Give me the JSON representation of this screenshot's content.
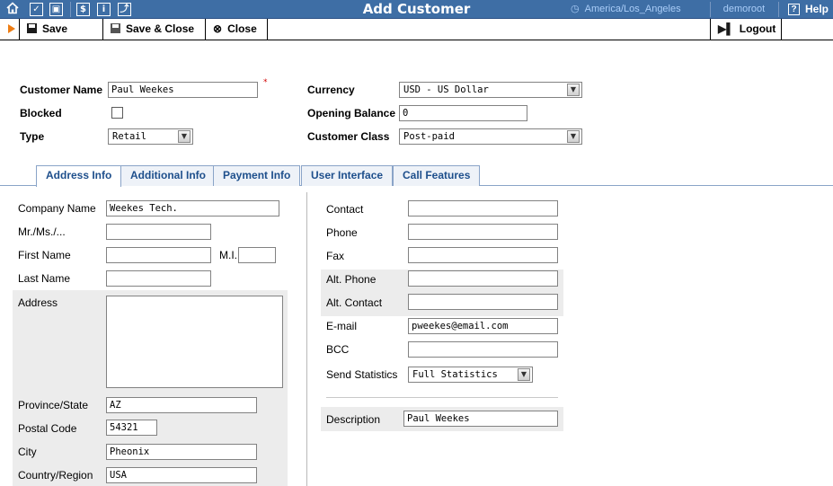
{
  "topbar": {
    "title": "Add Customer",
    "timezone": "America/Los_Angeles",
    "user": "demoroot",
    "help": "Help",
    "icons": [
      "home-icon",
      "checkbox-icon",
      "grid-icon",
      "dollar-icon",
      "info-icon",
      "chart-icon"
    ]
  },
  "toolbar": {
    "save": "Save",
    "save_close": "Save & Close",
    "close": "Close",
    "logout": "Logout"
  },
  "customer": {
    "name_label": "Customer Name",
    "name_value": "Paul Weekes",
    "blocked_label": "Blocked",
    "blocked_checked": false,
    "type_label": "Type",
    "type_value": "Retail",
    "currency_label": "Currency",
    "currency_value": "USD - US Dollar",
    "opening_balance_label": "Opening Balance",
    "opening_balance_value": "0",
    "class_label": "Customer Class",
    "class_value": "Post-paid"
  },
  "tabs": [
    "Address Info",
    "Additional Info",
    "Payment Info",
    "User Interface",
    "Call Features"
  ],
  "address": {
    "company_label": "Company Name",
    "company_value": "Weekes Tech.",
    "salutation_label": "Mr./Ms./...",
    "salutation_value": "",
    "first_label": "First Name",
    "first_value": "",
    "mi_label": "M.I.",
    "mi_value": "",
    "last_label": "Last Name",
    "last_value": "",
    "address_label": "Address",
    "address_value": "",
    "province_label": "Province/State",
    "province_value": "AZ",
    "postal_label": "Postal Code",
    "postal_value": "54321",
    "city_label": "City",
    "city_value": "Pheonix",
    "country_label": "Country/Region",
    "country_value": "USA"
  },
  "contact": {
    "contact_label": "Contact",
    "contact_value": "",
    "phone_label": "Phone",
    "phone_value": "",
    "fax_label": "Fax",
    "fax_value": "",
    "alt_phone_label": "Alt. Phone",
    "alt_phone_value": "",
    "alt_contact_label": "Alt. Contact",
    "alt_contact_value": "",
    "email_label": "E-mail",
    "email_value": "pweekes@email.com",
    "bcc_label": "BCC",
    "bcc_value": "",
    "stats_label": "Send Statistics",
    "stats_value": "Full Statistics",
    "description_label": "Description",
    "description_value": "Paul Weekes"
  },
  "colors": {
    "topbar_bg": "#3e6ea5",
    "accent_orange": "#ee7d14",
    "tab_text": "#1e4f8c",
    "required": "#d10000"
  }
}
